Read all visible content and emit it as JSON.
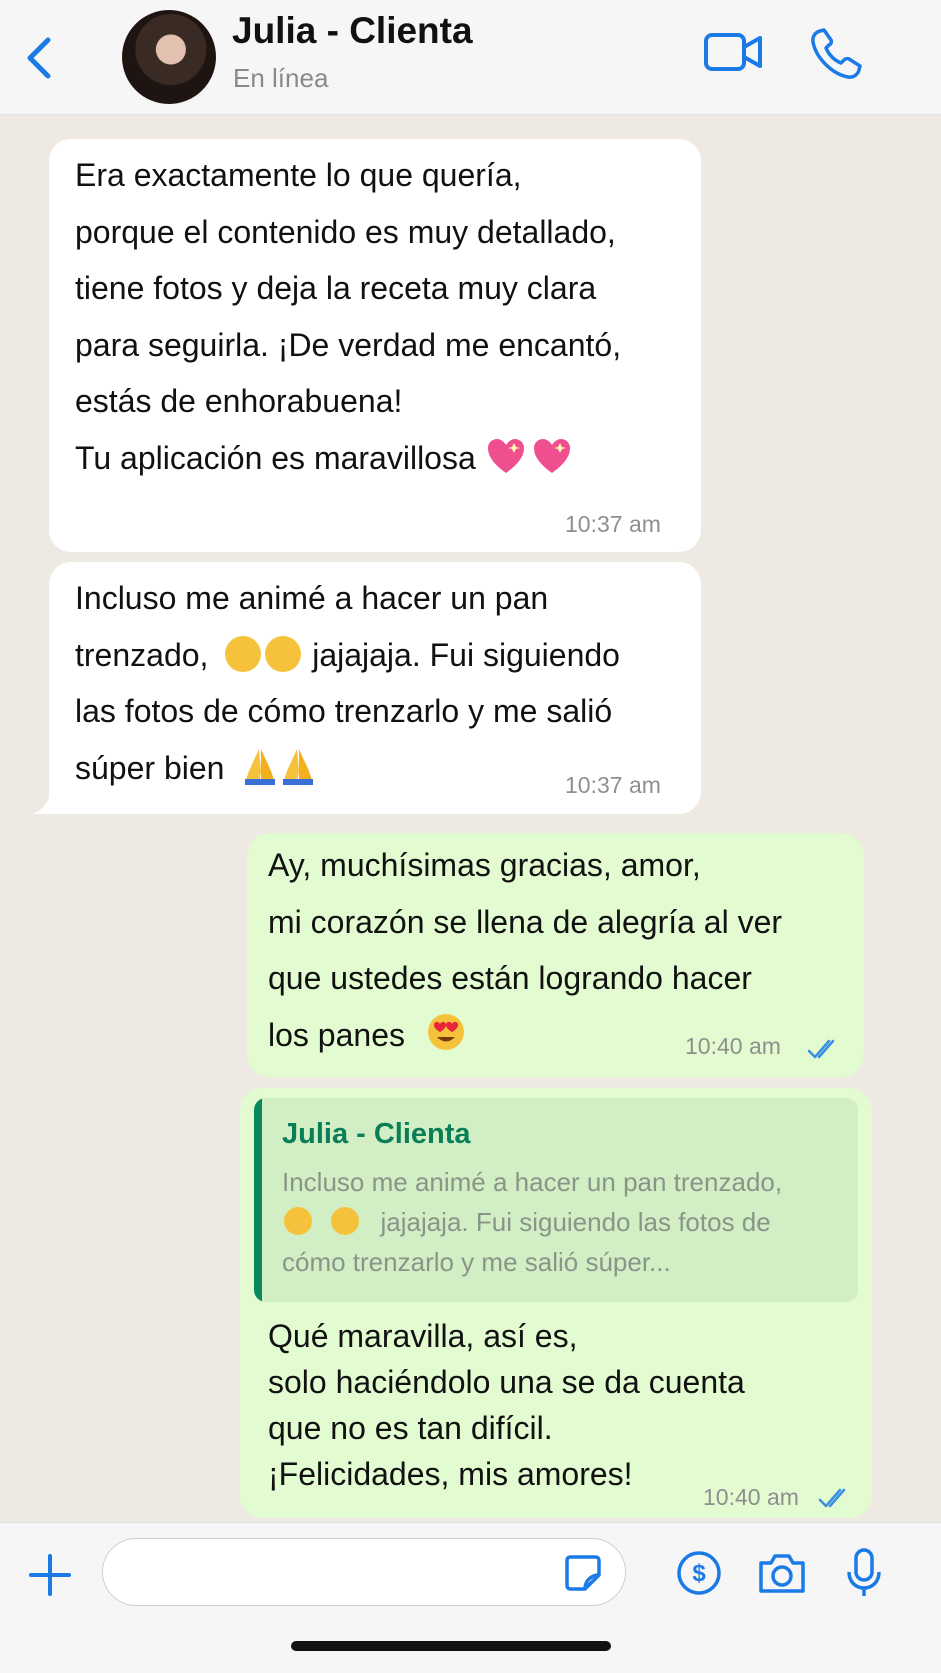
{
  "header": {
    "contact_name": "Julia - Clienta",
    "status": "En línea"
  },
  "messages": [
    {
      "direction": "incoming",
      "text": "Era exactamente lo que quería,\nporque el contenido es muy detallado,\ntiene fotos y deja la receta muy clara\npara seguirla. ¡De verdad me encantó,\nestás de enhorabuena!\nTu aplicación es maravillosa",
      "emoji": [
        "sparkling-heart",
        "sparkling-heart"
      ],
      "time": "10:37 am"
    },
    {
      "direction": "incoming",
      "line1": "Incluso me animé a hacer un pan",
      "line2a": "trenzado,",
      "line2b": "jajajaja. Fui siguiendo",
      "line3": "las fotos de cómo trenzarlo y me salió",
      "line4": "súper bien",
      "time": "10:37 am"
    },
    {
      "direction": "outgoing",
      "text": "Ay, muchísimas gracias, amor,\nmi corazón se llena de alegría al ver\nque ustedes están logrando hacer\nlos panes",
      "time": "10:40 am",
      "status": "read"
    },
    {
      "direction": "outgoing",
      "reply_to": {
        "name": "Julia - Clienta",
        "line1": "Incluso me animé a hacer un pan trenzado,",
        "line2": "jajajaja. Fui siguiendo las fotos de",
        "line3": "cómo trenzarlo y me salió súper..."
      },
      "text": "Qué maravilla, así es,\nsolo haciéndolo una se da cuenta\nque no es tan difícil.\n¡Felicidades, mis amores!",
      "time": "10:40 am",
      "status": "read"
    }
  ],
  "composer": {
    "placeholder": ""
  },
  "colors": {
    "accent": "#1a7ae6",
    "outgoing_bubble": "#e2fbd0",
    "incoming_bubble": "#ffffff",
    "reply_name": "#0a7f57"
  }
}
